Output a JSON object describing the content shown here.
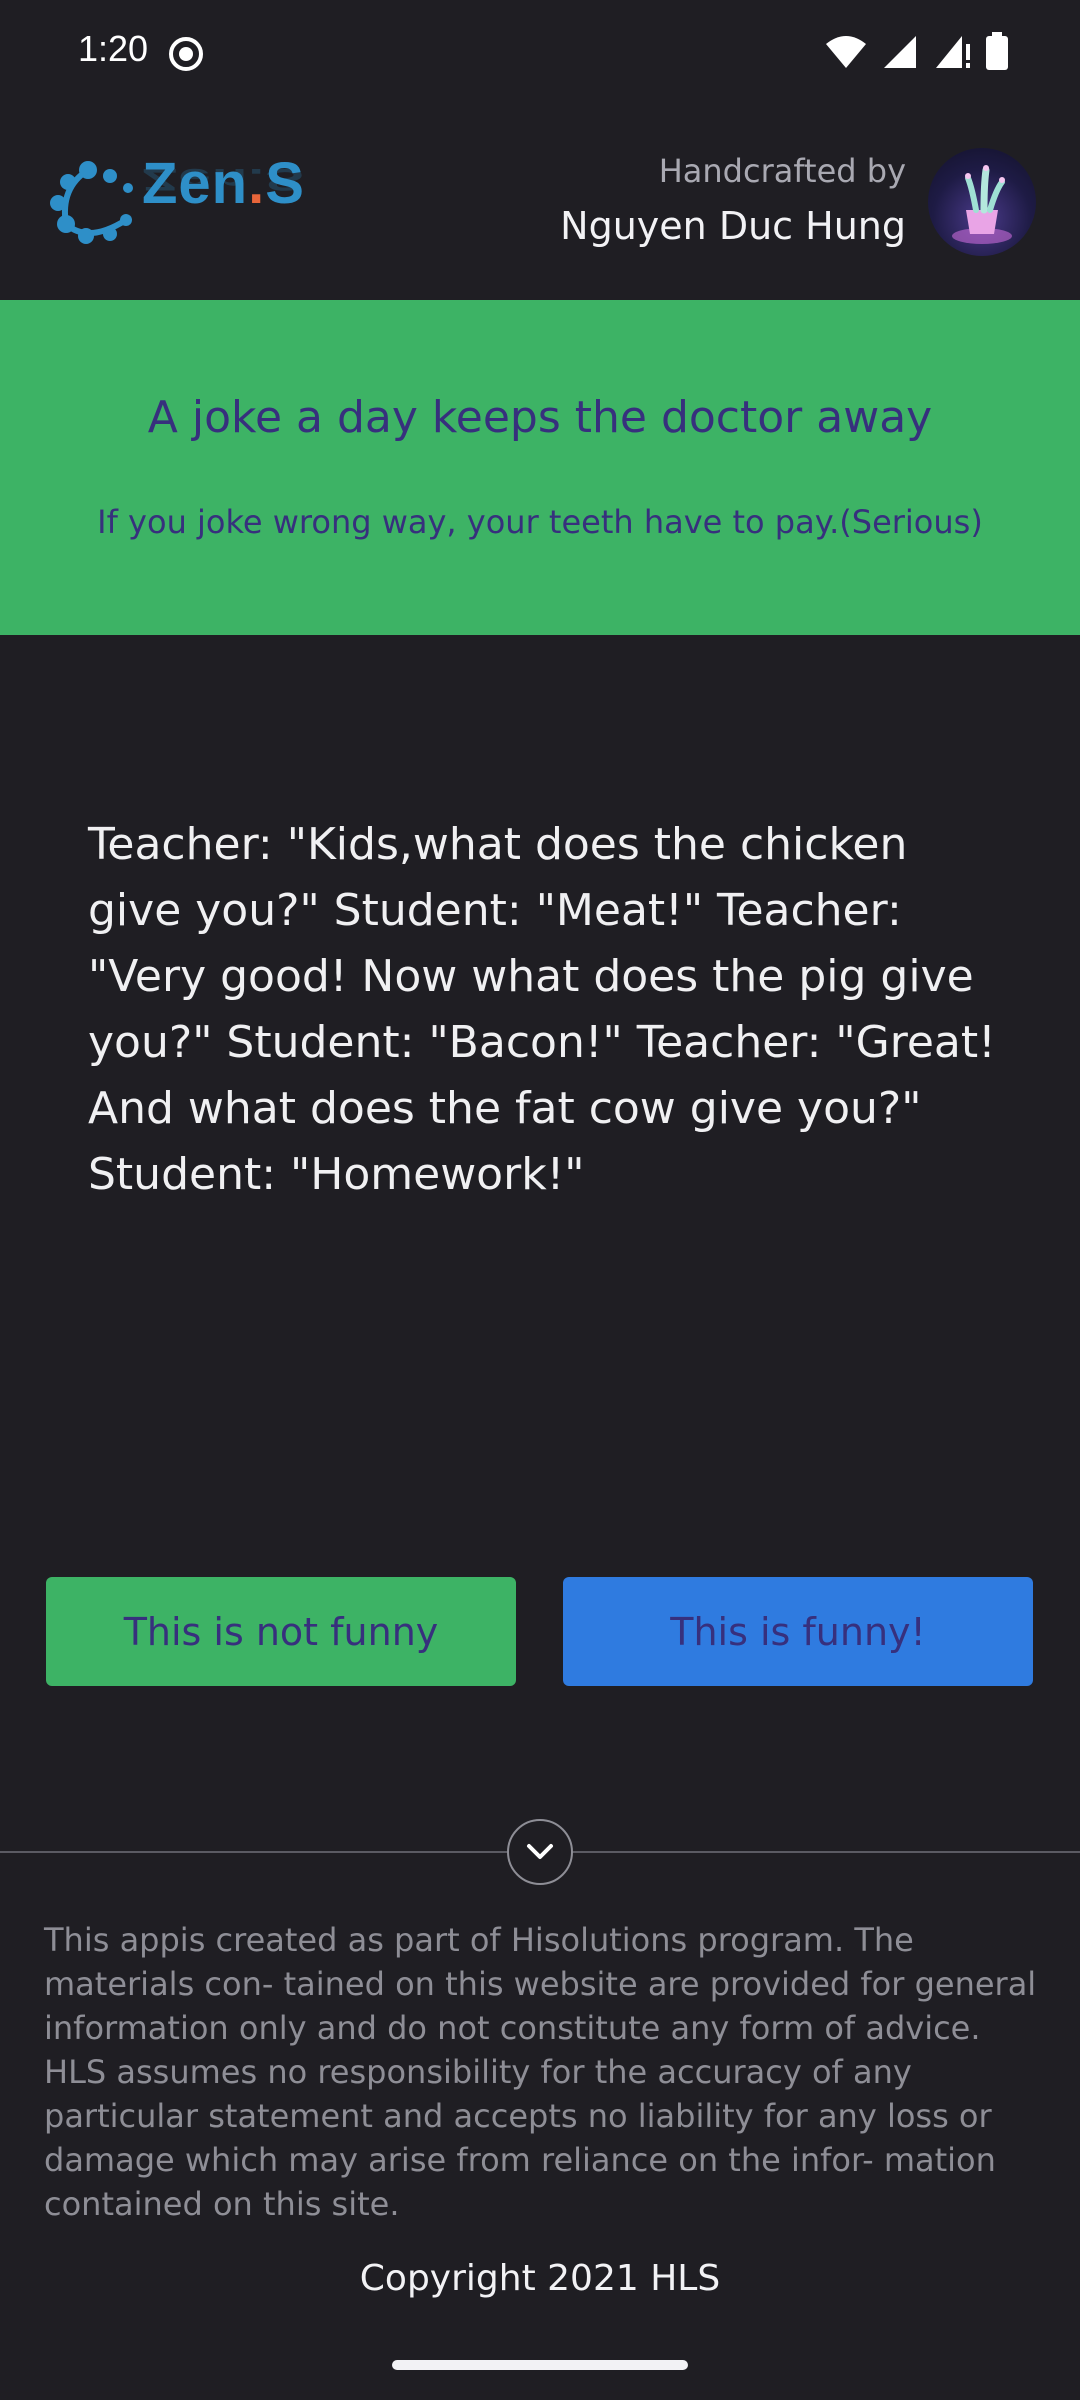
{
  "status_bar": {
    "time": "1:20",
    "icons": [
      "screen-record-icon",
      "wifi-icon",
      "signal-icon",
      "signal-no-data-icon",
      "battery-icon"
    ]
  },
  "header": {
    "logo_text": "Zen.S",
    "crafted_label": "Handcrafted by",
    "author_name": "Nguyen Duc Hung",
    "avatar_icon": "plant-avatar-icon"
  },
  "banner": {
    "title": "A joke a day keeps the doctor away",
    "subtitle": "If you joke wrong way, your teeth have to pay.(Serious)",
    "background_color": "#3db365",
    "text_color": "#37307d"
  },
  "joke": {
    "text": "Teacher: \"Kids,what does the chicken give you?\" Student: \"Meat!\" Teacher: \"Very good! Now what does the pig give you?\" Student: \"Bacon!\" Teacher: \"Great! And what does the fat cow give you?\" Student: \"Homework!\""
  },
  "actions": {
    "not_funny_label": "This is not funny",
    "funny_label": "This is funny!",
    "not_funny_color": "#3db365",
    "funny_color": "#2f7be0"
  },
  "footer": {
    "expand_icon": "chevron-down-icon",
    "disclaimer": "This appis created as part of Hisolutions program. The materials con- tained on this website are provided for general information only and do not constitute any form of advice. HLS assumes no responsibility for the accuracy of any particular statement and accepts no liability for any loss or damage which may arise from reliance on the infor- mation contained on this site.",
    "copyright": "Copyright 2021 HLS"
  },
  "colors": {
    "background": "#1f1e23",
    "logo_blue": "#2e8fc8",
    "logo_dot": "#e8653a"
  }
}
